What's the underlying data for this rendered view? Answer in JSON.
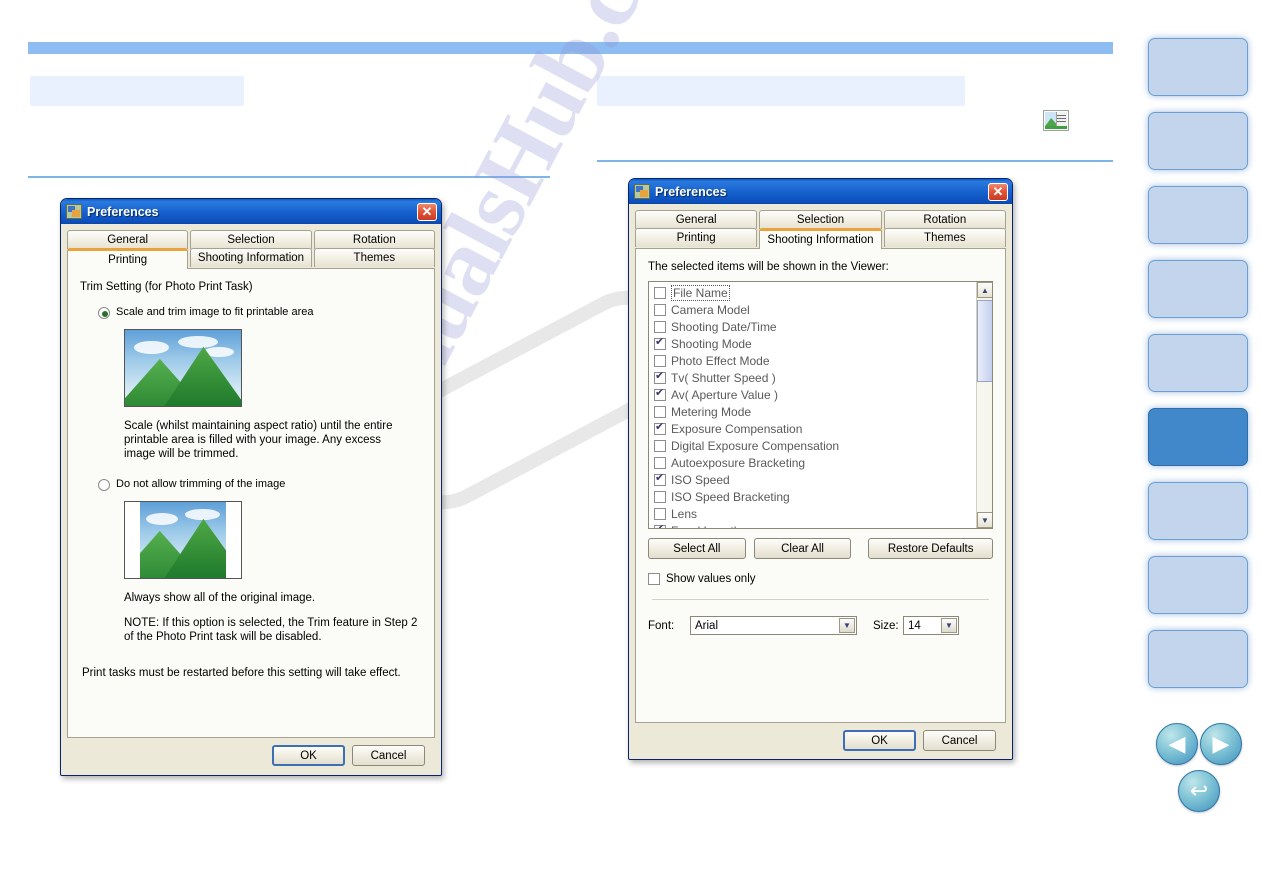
{
  "page": {
    "watermark": "ManualsHub.com"
  },
  "viewer_icon": {
    "name": "image-viewer-icon"
  },
  "sidebar": {
    "buttons": [
      {
        "label": "",
        "active": false
      },
      {
        "label": "",
        "active": false
      },
      {
        "label": "",
        "active": false
      },
      {
        "label": "",
        "active": false
      },
      {
        "label": "",
        "active": false
      },
      {
        "label": "",
        "active": true
      },
      {
        "label": "",
        "active": false
      },
      {
        "label": "",
        "active": false
      },
      {
        "label": "",
        "active": false
      }
    ],
    "nav": {
      "prev": "◀",
      "next": "▶",
      "back": "↩"
    }
  },
  "dialog_left": {
    "title": "Preferences",
    "close_label": "✕",
    "tabs_row1": [
      {
        "label": "General",
        "active": false
      },
      {
        "label": "Selection",
        "active": false
      },
      {
        "label": "Rotation",
        "active": false
      }
    ],
    "tabs_row2": [
      {
        "label": "Printing",
        "active": true
      },
      {
        "label": "Shooting Information",
        "active": false
      },
      {
        "label": "Themes",
        "active": false
      }
    ],
    "group_label": "Trim Setting (for Photo Print Task)",
    "option1": {
      "label": "Scale and trim image to fit printable area",
      "selected": true,
      "description": "Scale (whilst maintaining aspect ratio) until the entire printable area is filled with your image. Any excess image will be trimmed."
    },
    "option2": {
      "label": "Do not allow trimming of the image",
      "selected": false,
      "description": "Always show all of the original image.",
      "note": "NOTE: If this option is selected, the Trim feature in Step 2 of the Photo Print task will be disabled."
    },
    "footer_note": "Print tasks must be restarted before this setting will take effect.",
    "ok_label": "OK",
    "cancel_label": "Cancel"
  },
  "dialog_right": {
    "title": "Preferences",
    "close_label": "✕",
    "tabs_row1": [
      {
        "label": "General",
        "active": false
      },
      {
        "label": "Selection",
        "active": false
      },
      {
        "label": "Rotation",
        "active": false
      }
    ],
    "tabs_row2": [
      {
        "label": "Printing",
        "active": false
      },
      {
        "label": "Shooting Information",
        "active": true
      },
      {
        "label": "Themes",
        "active": false
      }
    ],
    "instruction": "The selected items will be shown in the Viewer:",
    "items": [
      {
        "label": "File Name",
        "checked": false,
        "focused": true
      },
      {
        "label": "Camera Model",
        "checked": false,
        "focused": false
      },
      {
        "label": "Shooting Date/Time",
        "checked": false,
        "focused": false
      },
      {
        "label": "Shooting Mode",
        "checked": true,
        "focused": false
      },
      {
        "label": "Photo Effect Mode",
        "checked": false,
        "focused": false
      },
      {
        "label": "Tv( Shutter Speed )",
        "checked": true,
        "focused": false
      },
      {
        "label": "Av( Aperture Value )",
        "checked": true,
        "focused": false
      },
      {
        "label": "Metering Mode",
        "checked": false,
        "focused": false
      },
      {
        "label": "Exposure Compensation",
        "checked": true,
        "focused": false
      },
      {
        "label": "Digital Exposure Compensation",
        "checked": false,
        "focused": false
      },
      {
        "label": "Autoexposure Bracketing",
        "checked": false,
        "focused": false
      },
      {
        "label": "ISO Speed",
        "checked": true,
        "focused": false
      },
      {
        "label": "ISO Speed Bracketing",
        "checked": false,
        "focused": false
      },
      {
        "label": "Lens",
        "checked": false,
        "focused": false
      },
      {
        "label": "Focal Length",
        "checked": true,
        "focused": false
      }
    ],
    "select_all_label": "Select All",
    "clear_all_label": "Clear All",
    "restore_defaults_label": "Restore Defaults",
    "show_values_only": {
      "label": "Show values only",
      "checked": false
    },
    "font_label": "Font:",
    "font_value": "Arial",
    "size_label": "Size:",
    "size_value": "14",
    "ok_label": "OK",
    "cancel_label": "Cancel",
    "scroll_up_glyph": "▲",
    "scroll_down_glyph": "▼",
    "combo_arrow_glyph": "▼"
  }
}
